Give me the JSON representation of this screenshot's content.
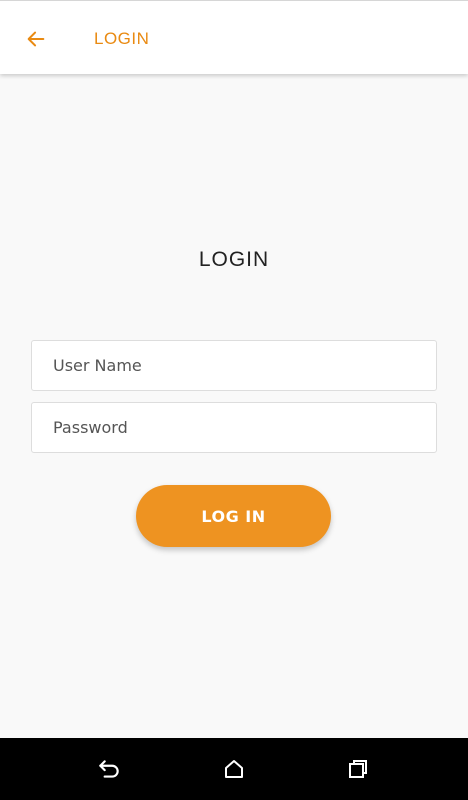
{
  "app_bar": {
    "title": "LOGIN",
    "back_icon": "arrow-left-icon"
  },
  "form": {
    "heading": "LOGIN",
    "username": {
      "placeholder": "User Name",
      "value": ""
    },
    "password": {
      "placeholder": "Password",
      "value": ""
    },
    "submit_label": "LOG IN"
  },
  "system_nav": {
    "icons": [
      "back-icon",
      "home-icon",
      "recent-apps-icon"
    ]
  },
  "colors": {
    "accent": "#ee9321",
    "title": "#e98a12",
    "background": "#f9f9f9",
    "nav_bar": "#000000"
  }
}
